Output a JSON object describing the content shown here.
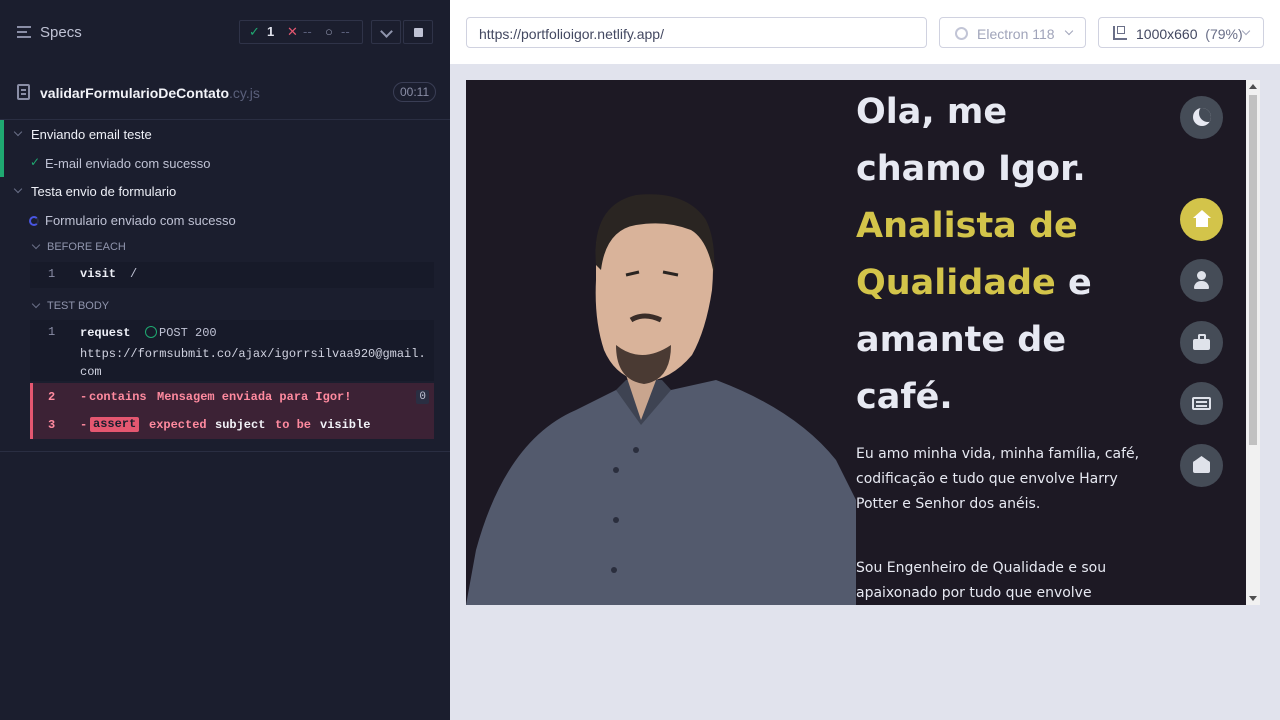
{
  "reporter": {
    "specs_label": "Specs",
    "stats": {
      "passed": "1",
      "failed": "--",
      "pending": "--"
    },
    "spec_file": {
      "name": "validarFormularioDeContato",
      "ext": ".cy.js",
      "duration": "00:11"
    },
    "suites": [
      {
        "title": "Enviando email teste",
        "tests": [
          {
            "title": "E-mail enviado com sucesso",
            "state": "passed"
          }
        ]
      },
      {
        "title": "Testa envio de formulario",
        "tests": [
          {
            "title": "Formulario enviado com sucesso",
            "state": "running"
          }
        ]
      }
    ],
    "hooks": {
      "before_each": "BEFORE EACH",
      "test_body": "TEST BODY"
    },
    "commands": {
      "visit": {
        "num": "1",
        "name": "visit",
        "arg": "/"
      },
      "request": {
        "num": "1",
        "name": "request",
        "status": "POST 200",
        "url": "https://formsubmit.co/ajax/igorrsilvaa920@gmail.com"
      },
      "contains": {
        "num": "2",
        "dash": "-",
        "name": "contains",
        "arg": "Mensagem enviada para Igor!",
        "count": "0"
      },
      "assert": {
        "num": "3",
        "dash": "-",
        "tag": "assert",
        "w1": "expected",
        "w2": "subject",
        "w3": "to be",
        "w4": "visible"
      }
    }
  },
  "topbar": {
    "url": "https://portfolioigor.netlify.app/",
    "browser": "Electron 118",
    "viewport": "1000x660",
    "zoom": "(79%)"
  },
  "aut": {
    "hero": {
      "l1": "Ola, me",
      "l2": "chamo Igor.",
      "l3": "Analista de",
      "l4a": "Qualidade",
      "l4b": "e",
      "l5": "amante de",
      "l6": "café."
    },
    "bio1": "Eu amo minha vida, minha família, café, codificação e tudo que envolve Harry Potter e Senhor dos anéis.",
    "bio2": "Sou Engenheiro de Qualidade e sou apaixonado por tudo que envolve",
    "accent": "#d3c44a",
    "nav_icons": [
      "moon-icon",
      "home-icon",
      "user-icon",
      "briefcase-icon",
      "newspaper-icon",
      "envelope-icon"
    ]
  }
}
